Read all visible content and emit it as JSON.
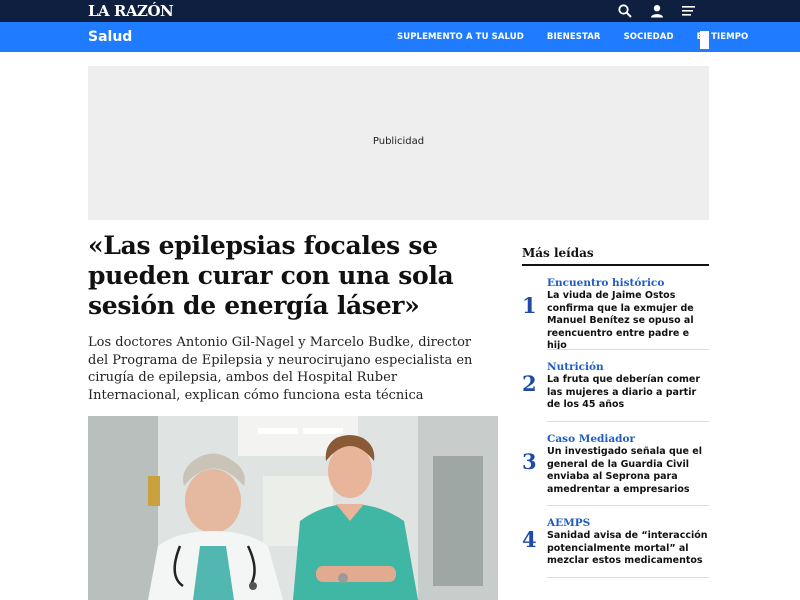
{
  "brand": {
    "logo": "LA RAZÓN"
  },
  "nav": {
    "section": "Salud",
    "links": [
      "SUPLEMENTO A TU SALUD",
      "BIENESTAR",
      "SOCIEDAD",
      "EL TIEMPO"
    ]
  },
  "icons": {
    "search": "search-icon",
    "user": "user-icon",
    "menu": "menu-icon"
  },
  "ad": {
    "label": "Publicidad"
  },
  "article": {
    "headline": "«Las epilepsias focales se pueden curar con una sola sesión de energía láser»",
    "subhead": "Los doctores Antonio Gil-Nagel y Marcelo Budke, director del Programa de Epilepsia y neurocirujano especialista en cirugía de epilepsia, ambos del Hospital Ruber Internacional, explican cómo funciona esta técnica"
  },
  "most_read": {
    "title": "Más leídas",
    "items": [
      {
        "number": "1",
        "category": "Encuentro histórico",
        "text": "La viuda de Jaime Ostos confirma que la exmujer de Manuel Benítez se opuso al reencuentro entre padre e hijo"
      },
      {
        "number": "2",
        "category": "Nutrición",
        "text": "La fruta que deberían comer las mujeres a diario a partir de los 45 años"
      },
      {
        "number": "3",
        "category": "Caso Mediador",
        "text": "Un investigado señala que el general de la Guardia Civil enviaba al Seprona para amedrentar a empresarios"
      },
      {
        "number": "4",
        "category": "AEMPS",
        "text": "Sanidad avisa de “interacción potencialmente mortal” al mezclar estos medicamentos"
      }
    ]
  },
  "colors": {
    "topbar": "#0f1f40",
    "navbar": "#1f7bff",
    "accent_number": "#1f4aa8",
    "accent_category": "#1f5bc4"
  }
}
